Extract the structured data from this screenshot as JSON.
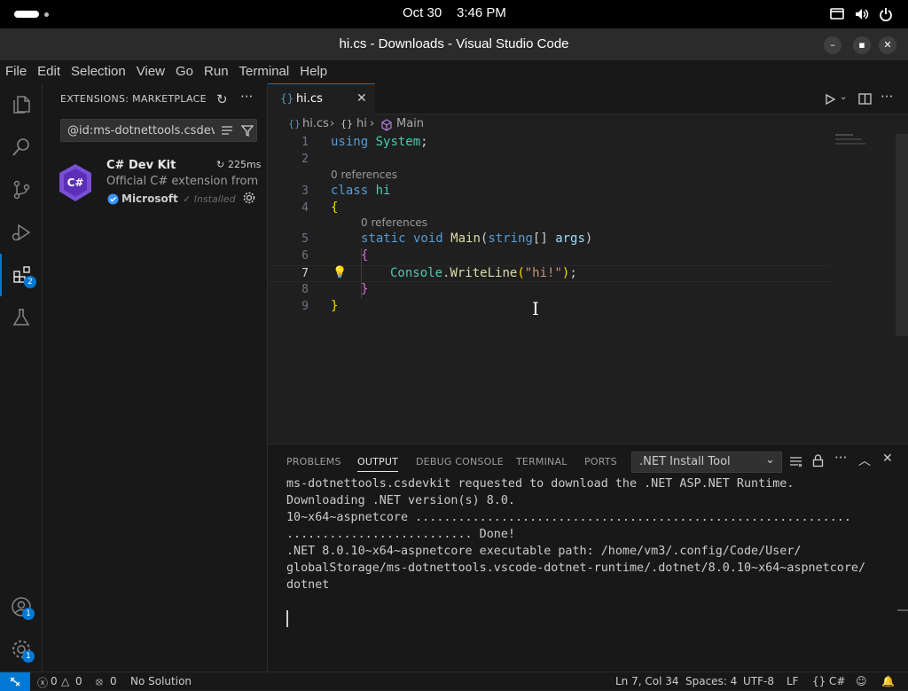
{
  "system": {
    "date": "Oct 30",
    "time": "3:46 PM"
  },
  "window": {
    "title": "hi.cs - Downloads - Visual Studio Code"
  },
  "menu": [
    "File",
    "Edit",
    "Selection",
    "View",
    "Go",
    "Run",
    "Terminal",
    "Help"
  ],
  "activity": {
    "extensions_badge": "2",
    "accounts_badge": "1",
    "manage_badge": "1"
  },
  "sidebar": {
    "title": "EXTENSIONS: MARKETPLACE",
    "search_value": "@id:ms-dotnettools.csdevkit",
    "extension": {
      "name": "C# Dev Kit",
      "time": "225ms",
      "description": "Official C# extension from ...",
      "publisher": "Microsoft",
      "status": "✓ Installed",
      "icon_text": "C#"
    }
  },
  "editor": {
    "tab": "hi.cs",
    "breadcrumb": {
      "file": "hi.cs",
      "ns": "hi",
      "method": "Main"
    },
    "references": "0 references",
    "line_numbers": [
      "1",
      "2",
      "3",
      "4",
      "5",
      "6",
      "7",
      "8",
      "9"
    ],
    "code": {
      "l1_kw": "using",
      "l1_ns": " System",
      "l1_end": ";",
      "l3_kw": "class",
      "l3_name": " hi",
      "l4": "{",
      "l5_kw1": "static",
      "l5_kw2": " void",
      "l5_fn": " Main",
      "l5_open": "(",
      "l5_type": "string",
      "l5_arr": "[]",
      "l5_param": " args",
      "l5_close": ")",
      "l6": "{",
      "l7_cls": "Console",
      "l7_dot": ".",
      "l7_fn": "WriteLine",
      "l7_open": "(",
      "l7_str": "\"hi!\"",
      "l7_close": ")",
      "l7_end": ";",
      "l8": "}",
      "l9": "}"
    }
  },
  "panel": {
    "tabs": [
      "PROBLEMS",
      "OUTPUT",
      "DEBUG CONSOLE",
      "TERMINAL",
      "PORTS"
    ],
    "active_tab": "OUTPUT",
    "channel": ".NET Install Tool",
    "output_lines": [
      "ms-dotnettools.csdevkit requested to download the .NET ASP.NET Runtime.",
      "Downloading .NET version(s) 8.0.",
      "10~x64~aspnetcore .............................................................",
      ".......................... Done!",
      ".NET 8.0.10~x64~aspnetcore executable path: /home/vm3/.config/Code/User/",
      "globalStorage/ms-dotnettools.vscode-dotnet-runtime/.dotnet/8.0.10~x64~aspnetcore/",
      "dotnet"
    ]
  },
  "status": {
    "errors": "0",
    "warnings": "0",
    "ports": "0",
    "solution": "No Solution",
    "position": "Ln 7, Col 34",
    "spaces": "Spaces: 4",
    "encoding": "UTF-8",
    "eol": "LF",
    "language": "C#"
  },
  "colors": {
    "accent": "#0078d4",
    "background": "#1f1f1f",
    "sidebar": "#181818"
  }
}
